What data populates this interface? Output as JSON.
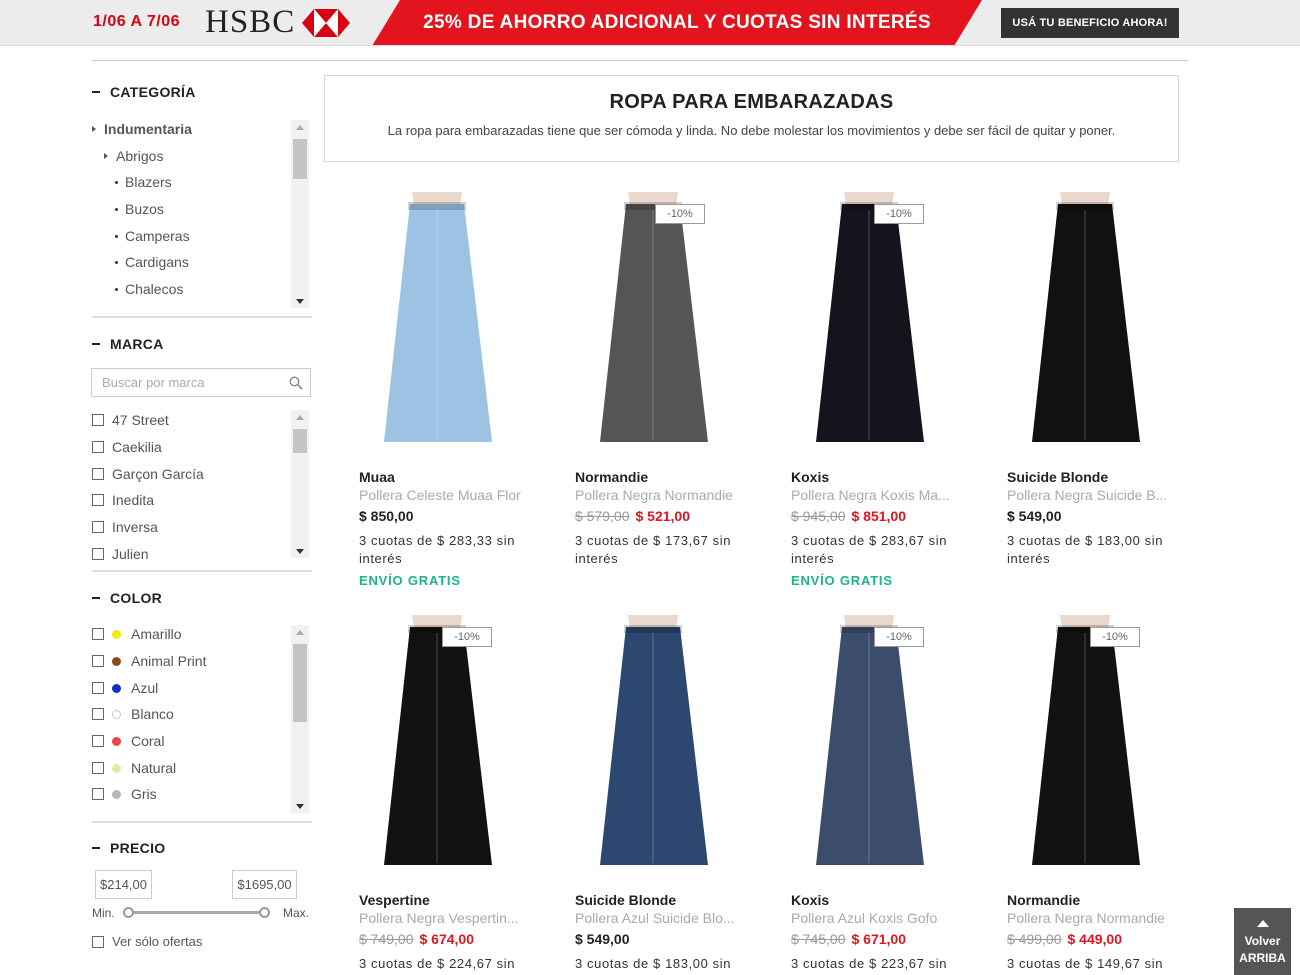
{
  "banner": {
    "dates": "1/06 A 7/06",
    "bank": "HSBC",
    "promo": "25% DE AHORRO ADICIONAL Y CUOTAS SIN INTERÉS",
    "cta": "USÁ TU BENEFICIO AHORA!",
    "color_red": "#e4141e"
  },
  "sidebar": {
    "category": {
      "title": "CATEGORÍA",
      "items": [
        {
          "label": "Indumentaria",
          "level": 0
        },
        {
          "label": "Abrigos",
          "level": 1
        },
        {
          "label": "Blazers",
          "level": 2
        },
        {
          "label": "Buzos",
          "level": 2
        },
        {
          "label": "Camperas",
          "level": 2
        },
        {
          "label": "Cardigans",
          "level": 2
        },
        {
          "label": "Chalecos",
          "level": 2
        }
      ]
    },
    "brand": {
      "title": "MARCA",
      "search_placeholder": "Buscar por marca",
      "items": [
        "47 Street",
        "Caekilia",
        "Garçon García",
        "Inedita",
        "Inversa",
        "Julien"
      ]
    },
    "color": {
      "title": "COLOR",
      "items": [
        {
          "label": "Amarillo",
          "swatch": "#f2ea10"
        },
        {
          "label": "Animal Print",
          "swatch": "#8a4b1c"
        },
        {
          "label": "Azul",
          "swatch": "#1530c8"
        },
        {
          "label": "Blanco",
          "swatch": "#ffffff"
        },
        {
          "label": "Coral",
          "swatch": "#ee4444"
        },
        {
          "label": "Natural",
          "swatch": "#e4e9a8"
        },
        {
          "label": "Gris",
          "swatch": "#b8b8b8"
        }
      ]
    },
    "price": {
      "title": "PRECIO",
      "min_value": "$214,00",
      "max_value": "$1695,00",
      "min_label": "Min.",
      "max_label": "Max.",
      "offers_only": "Ver sólo ofertas"
    }
  },
  "intro": {
    "title": "ROPA PARA EMBARAZADAS",
    "text": "La ropa para embarazadas tiene que ser cómoda y linda. No debe molestar los movimientos y debe ser fácil de quitar y poner."
  },
  "products": [
    {
      "brand": "Muaa",
      "name": "Pollera Celeste Muaa Flor",
      "old_price": "",
      "price": "$ 850,00",
      "installments": "3 cuotas de $ 283,33 sin interés",
      "shipping": "ENVÍO GRATIS",
      "badge": "",
      "color": "#9cc3e4"
    },
    {
      "brand": "Normandie",
      "name": "Pollera Negra Normandie",
      "old_price": "$ 579,00",
      "price": "$ 521,00",
      "installments": "3 cuotas de $ 173,67 sin interés",
      "shipping": "",
      "badge": "-10%",
      "color": "#555555"
    },
    {
      "brand": "Koxis",
      "name": "Pollera Negra Koxis Ma...",
      "old_price": "$ 945,00",
      "price": "$ 851,00",
      "installments": "3 cuotas de $ 283,67 sin interés",
      "shipping": "ENVÍO GRATIS",
      "badge": "-10%",
      "color": "#14141c"
    },
    {
      "brand": "Suicide Blonde",
      "name": "Pollera Negra Suicide B...",
      "old_price": "",
      "price": "$ 549,00",
      "installments": "3 cuotas de $ 183,00 sin interés",
      "shipping": "",
      "badge": "",
      "color": "#111111"
    },
    {
      "brand": "Vespertine",
      "name": "Pollera Negra Vespertin...",
      "old_price": "$ 749,00",
      "price": "$ 674,00",
      "installments": "3 cuotas de $ 224,67 sin",
      "shipping": "",
      "badge": "-10%",
      "color": "#121212"
    },
    {
      "brand": "Suicide Blonde",
      "name": "Pollera Azul Suicide Blo...",
      "old_price": "",
      "price": "$ 549,00",
      "installments": "3 cuotas de $ 183,00 sin",
      "shipping": "",
      "badge": "",
      "color": "#2c4770"
    },
    {
      "brand": "Koxis",
      "name": "Pollera Azul Koxis Gofo",
      "old_price": "$ 745,00",
      "price": "$ 671,00",
      "installments": "3 cuotas de $ 223,67 sin",
      "shipping": "",
      "badge": "-10%",
      "color": "#3c4d6c"
    },
    {
      "brand": "Normandie",
      "name": "Pollera Negra Normandie",
      "old_price": "$ 499,00",
      "price": "$ 449,00",
      "installments": "3 cuotas de $ 149,67 sin",
      "shipping": "",
      "badge": "-10%",
      "color": "#121212"
    }
  ],
  "back_to_top": {
    "line1": "Volver",
    "line2": "ARRIBA"
  }
}
